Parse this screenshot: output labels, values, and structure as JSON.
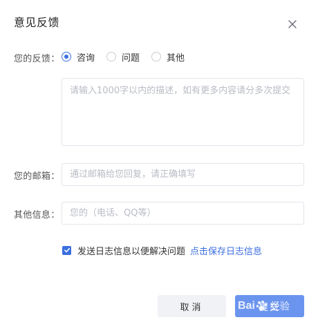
{
  "dialog": {
    "title": "意见反馈"
  },
  "feedback": {
    "label": "您的反馈：",
    "options": [
      "咨询",
      "问题",
      "其他"
    ],
    "selected": "咨询",
    "description_placeholder": "请输入1000字以内的描述，如有更多内容请分多次提交"
  },
  "email": {
    "label": "您的邮箱：",
    "placeholder": "通过邮箱给您回复，请正确填写"
  },
  "other_info": {
    "label": "其他信息：",
    "placeholder": "您的（电话、QQ等）"
  },
  "log": {
    "checked": true,
    "text": "发送日志信息以便解决问题",
    "link": "点击保存日志信息"
  },
  "buttons": {
    "cancel": "取消",
    "submit": "提交"
  },
  "watermark": {
    "brand": "Bai",
    "suffix": "经验"
  },
  "colors": {
    "accent": "#3b6fe0",
    "submit_bg": "#6b94ee",
    "cancel_bg": "#f0f2f5",
    "border": "#e1e4ea",
    "placeholder": "#b8bcc4"
  }
}
